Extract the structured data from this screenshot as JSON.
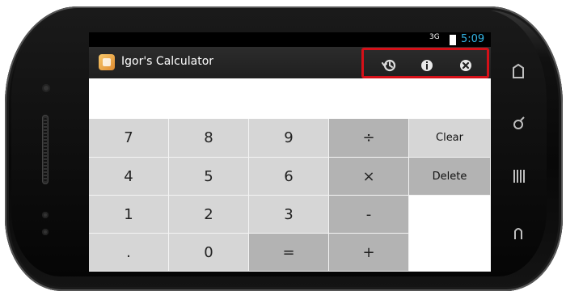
{
  "app": {
    "title": "Igor's Calculator"
  },
  "status_bar": {
    "network": "3G",
    "time": "5:09"
  },
  "action_bar": {
    "icons": [
      "history-icon",
      "info-icon",
      "close-icon"
    ],
    "highlight_color": "#d51018"
  },
  "display": {
    "value": ""
  },
  "keypad": {
    "rows": [
      [
        "7",
        "8",
        "9",
        "÷"
      ],
      [
        "4",
        "5",
        "6",
        "×"
      ],
      [
        "1",
        "2",
        "3",
        "-"
      ],
      [
        ".",
        "0",
        "=",
        "+"
      ]
    ],
    "side": {
      "clear": "Clear",
      "delete": "Delete"
    }
  },
  "colors": {
    "accent": "#33b5e5",
    "key_light": "#d6d6d6",
    "key_dark": "#b3b3b3"
  }
}
